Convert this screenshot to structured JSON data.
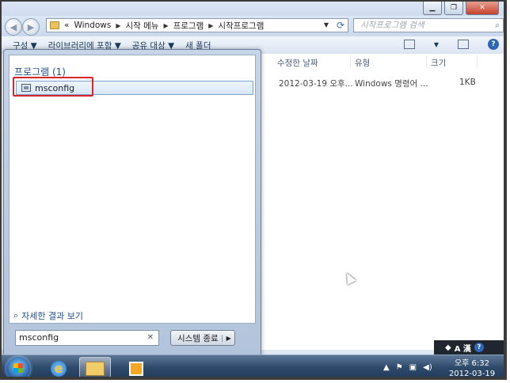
{
  "address": {
    "prefix": "«",
    "crumbs": [
      "Windows",
      "시작 메뉴",
      "프로그램",
      "시작프로그램"
    ]
  },
  "search": {
    "placeholder": "시작프로그램 검색"
  },
  "commandbar": {
    "items": [
      "구성 ▼",
      "라이브러리에 포함 ▼",
      "공유 대상 ▼",
      "새 폴더"
    ]
  },
  "columns": {
    "date": "수정한 날짜",
    "type": "유형",
    "size": "크기"
  },
  "file_row": {
    "date": "2012-03-19 오후...",
    "type": "Windows 명령어 ...",
    "size": "1KB"
  },
  "startmenu": {
    "header": "프로그램 (1)",
    "result": "msconfig",
    "see_more": "자세한 결과 보기",
    "search_value": "msconfig",
    "shutdown_label": "시스템 종료"
  },
  "langbar": {
    "text": "A 漢"
  },
  "clock": {
    "time": "오후 6:32",
    "date": "2012-03-19"
  }
}
